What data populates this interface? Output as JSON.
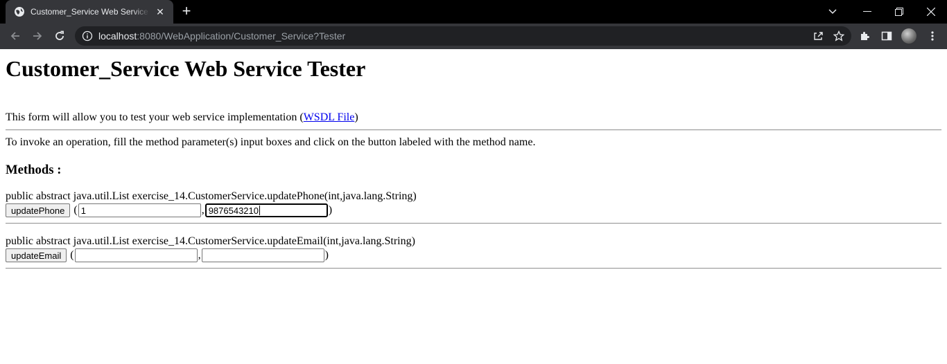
{
  "browser": {
    "tab_title": "Customer_Service Web Service Te",
    "url_host": "localhost",
    "url_rest": ":8080/WebApplication/Customer_Service?Tester"
  },
  "page": {
    "heading": "Customer_Service Web Service Tester",
    "intro_text": "This form will allow you to test your web service implementation (",
    "wsdl_link": "WSDL File",
    "intro_close": ")",
    "invoke_text": "To invoke an operation, fill the method parameter(s) input boxes and click on the button labeled with the method name.",
    "methods_heading": "Methods :"
  },
  "methods": [
    {
      "signature": "public abstract java.util.List exercise_14.CustomerService.updatePhone(int,java.lang.String)",
      "button_label": "updatePhone",
      "param1_value": "1",
      "param2_value": "9876543210"
    },
    {
      "signature": "public abstract java.util.List exercise_14.CustomerService.updateEmail(int,java.lang.String)",
      "button_label": "updateEmail",
      "param1_value": "",
      "param2_value": ""
    }
  ],
  "punct": {
    "open": "(",
    "comma": ",",
    "close": ")"
  }
}
